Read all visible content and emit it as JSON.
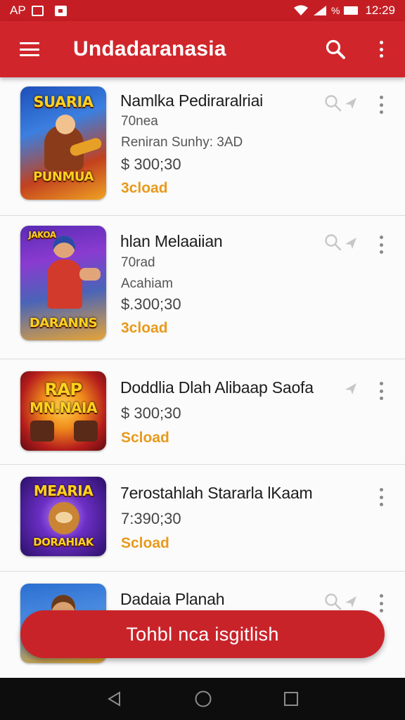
{
  "status_bar": {
    "left_text": "AP",
    "battery_text": "%",
    "time": "12:29"
  },
  "app_bar": {
    "title": "Undadaranasia",
    "menu_icon": "hamburger-menu-icon",
    "search_icon": "search-icon",
    "more_icon": "more-vert-icon"
  },
  "items": [
    {
      "title": "Namlka Pediraralriai",
      "line1": "70nea",
      "line2": "Reniran Sunhy: 3AD",
      "price": "$ 300;30",
      "action": "3cload",
      "thumb_top": "SUARIA",
      "thumb_bottom": "PUNMUA",
      "colors": [
        "#1a5fc9",
        "#f3a21c"
      ]
    },
    {
      "title": "hlan Melaaiian",
      "line1": "70rad",
      "line2": "Acahiam",
      "price": "$.300;30",
      "action": "3cload",
      "thumb_top": "JAKOA",
      "thumb_bottom": "DARANNS",
      "colors": [
        "#6b2fb8",
        "#e0402a"
      ]
    },
    {
      "title": "Doddlia Dlah Alibaap Saofa",
      "price": "$ 300;30",
      "action": "Scload",
      "thumb_top": "RAP",
      "thumb_bottom": "MN.NAIA",
      "colors": [
        "#b3121a",
        "#f7a21e"
      ]
    },
    {
      "title": "7erostahlah Stararla lKaam",
      "price": "7:390;30",
      "action": "Scload",
      "thumb_top": "MEARIA",
      "thumb_bottom": "DORAHIAK",
      "colors": [
        "#4b1fa6",
        "#d8642a"
      ]
    },
    {
      "title": "Dadaia Planah",
      "thumb_top": "",
      "thumb_bottom": "",
      "colors": [
        "#2a6fd0",
        "#e2a52a"
      ]
    }
  ],
  "cta": {
    "label": "Tohbl nca isgitlish"
  },
  "nav": {
    "back_icon": "back-triangle-icon",
    "home_icon": "home-circle-icon",
    "recents_icon": "recents-square-icon"
  },
  "colors": {
    "primary": "#d0262b",
    "accent": "#e89a1c",
    "nav": "#0d0d0d"
  }
}
